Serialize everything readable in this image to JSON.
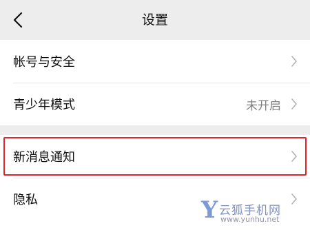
{
  "header": {
    "back_icon": "chevron-left-icon",
    "title": "设置"
  },
  "groups": [
    {
      "items": [
        {
          "label": "帐号与安全",
          "value": "",
          "icon": "chevron-right-icon"
        },
        {
          "label": "青少年模式",
          "value": "未开启",
          "icon": "chevron-right-icon"
        }
      ]
    },
    {
      "items": [
        {
          "label": "新消息通知",
          "value": "",
          "icon": "chevron-right-icon",
          "highlighted": true
        },
        {
          "label": "隐私",
          "value": "",
          "icon": "chevron-right-icon"
        }
      ]
    }
  ],
  "watermark": {
    "logo_letter": "Y",
    "name": "云狐手机网",
    "url": "www.yunhu.net"
  },
  "colors": {
    "background": "#ededed",
    "card": "#ffffff",
    "highlight_border": "#e0262b",
    "secondary_text": "#808080"
  }
}
